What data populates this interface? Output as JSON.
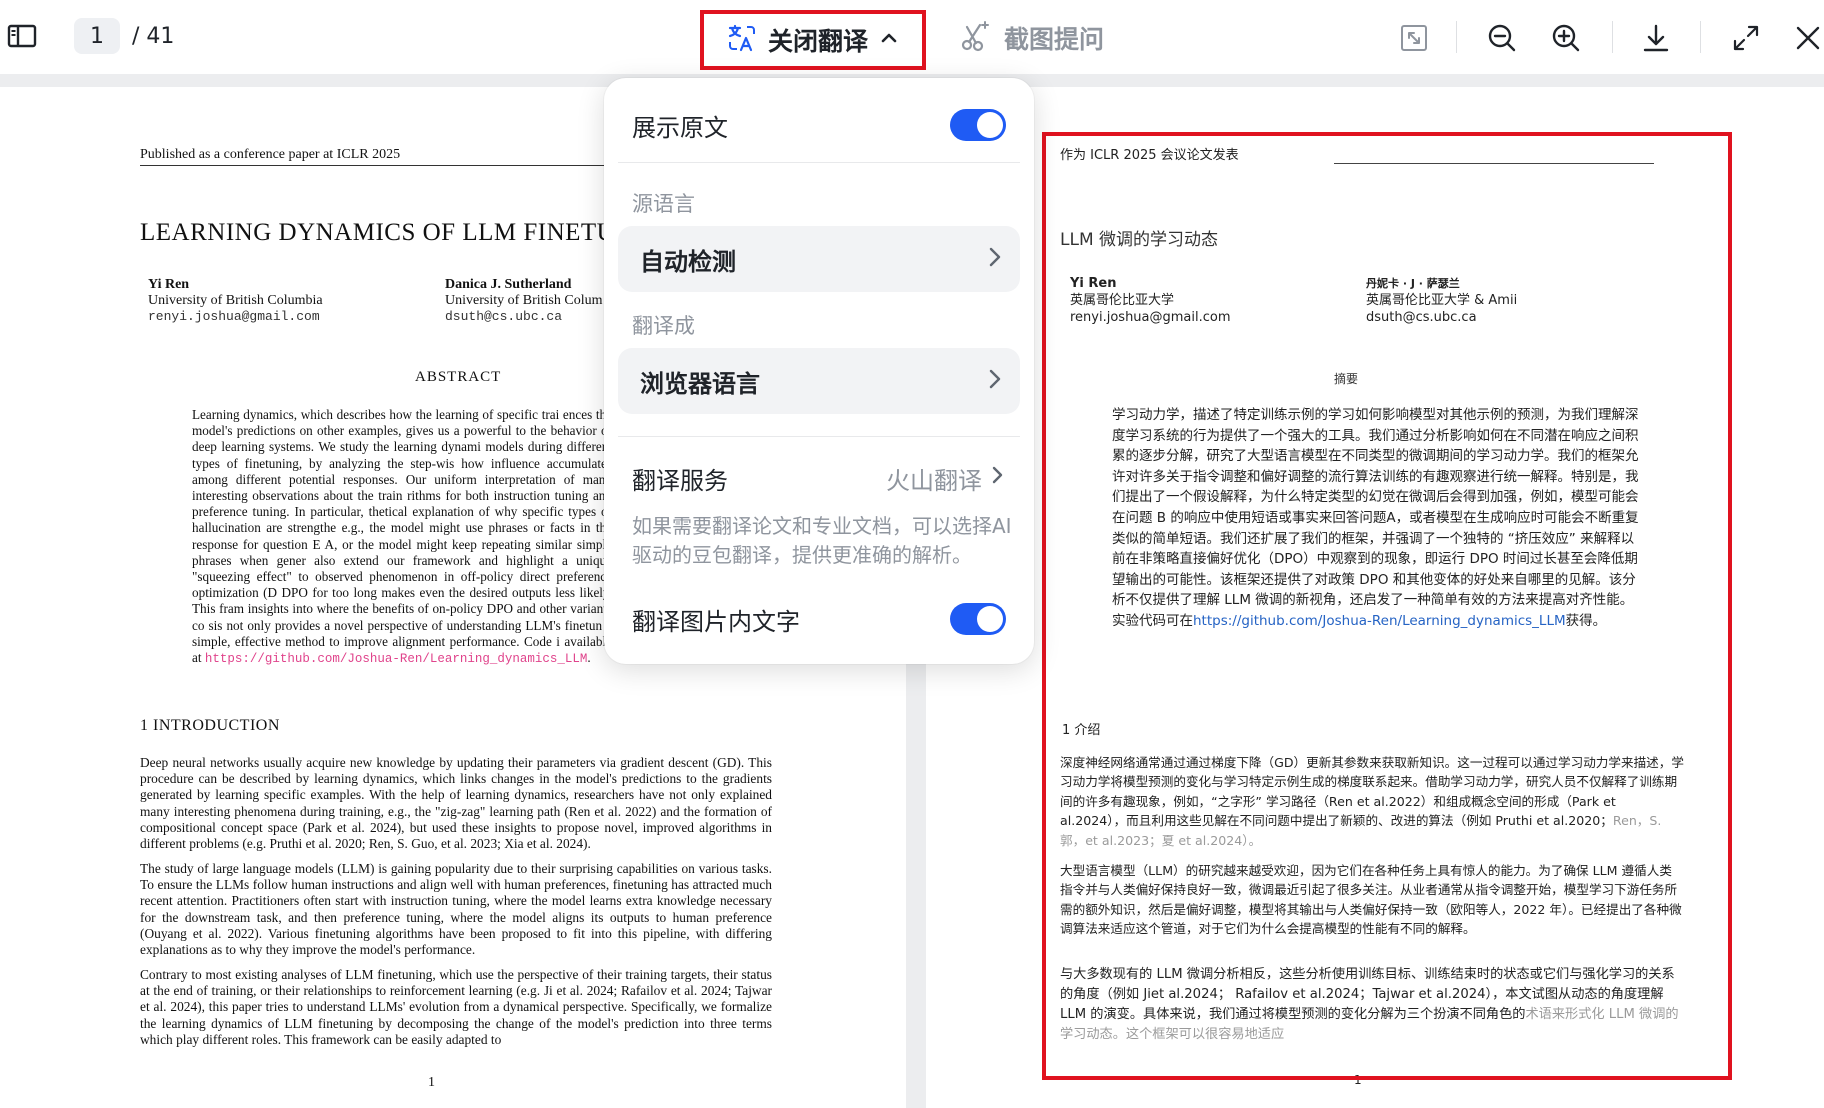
{
  "toolbar": {
    "page_current": "1",
    "page_total": "/ 41",
    "translate_label": "关闭翻译",
    "ask_label": "截图提问",
    "accent_color": "#1f5bf4",
    "highlight_color": "#e0121f"
  },
  "menu": {
    "show_original_label": "展示原文",
    "show_original_on": true,
    "source_lang_label": "源语言",
    "source_lang_value": "自动检测",
    "target_lang_label": "翻译成",
    "target_lang_value": "浏览器语言",
    "service_label": "翻译服务",
    "service_value": "火山翻译",
    "hint": "如果需要翻译论文和专业文档，可以选择AI 驱动的豆包翻译，提供更准确的解析。",
    "translate_image_label": "翻译图片内文字",
    "translate_image_on": true
  },
  "original": {
    "header": "Published as a conference paper at ICLR 2025",
    "title": "LEARNING DYNAMICS OF LLM FINETUNIN",
    "author1_name": "Yi Ren",
    "author1_affil": "University of British Columbia",
    "author1_email": "renyi.joshua@gmail.com",
    "author2_name": "Danica J. Sutherland",
    "author2_affil": "University of British Colum",
    "author2_email": "dsuth@cs.ubc.ca",
    "abstract_heading": "ABSTRACT",
    "abstract": "Learning dynamics, which describes how the learning of specific trai ences the model's predictions on other examples, gives us a powerful to the behavior of deep learning systems. We study the learning dynami models during different types of finetuning, by analyzing the step-wis how influence accumulates among different potential responses. Our uniform interpretation of many interesting observations about the train rithms for both instruction tuning and preference tuning. In particular, thetical explanation of why specific types of hallucination are strengthe e.g., the model might use phrases or facts in the response for question E A, or the model might keep repeating similar simple phrases when gener also extend our framework and highlight a unique \"squeezing effect\" to observed phenomenon in off-policy direct preference optimization (D DPO for too long makes even the desired outputs less likely. This fram insights into where the benefits of on-policy DPO and other variants co sis not only provides a novel perspective of understanding LLM's finetun a simple, effective method to improve alignment performance. Code i available at",
    "abstract_link": "https://github.com/Joshua-Ren/Learning_dynamics_LLM",
    "section_heading": "1 INTRODUCTION",
    "para1": "Deep neural networks usually acquire new knowledge by updating their parameters via gradient descent (GD). This procedure can be described by learning dynamics, which links changes in the model's predictions to the gradients generated by learning specific examples. With the help of learning dynamics, researchers have not only explained many interesting phenomena during training, e.g., the \"zig-zag\" learning path (Ren et al. 2022) and the formation of compositional concept space (Park et al. 2024), but used these insights to propose novel, improved algorithms in different problems (e.g. Pruthi et al. 2020; Ren, S. Guo, et al. 2023; Xia et al. 2024).",
    "para2": "The study of large language models (LLM) is gaining popularity due to their surprising capabilities on various tasks. To ensure the LLMs follow human instructions and align well with human preferences, finetuning has attracted much recent attention. Practitioners often start with instruction tuning, where the model learns extra knowledge necessary for the downstream task, and then preference tuning, where the model aligns its outputs to human preference (Ouyang et al. 2022). Various finetuning algorithms have been proposed to fit into this pipeline, with differing explanations as to why they improve the model's performance.",
    "para3": "Contrary to most existing analyses of LLM finetuning, which use the perspective of their training targets, their status at the end of training, or their relationships to reinforcement learning (e.g. Ji et al. 2024; Rafailov et al. 2024; Tajwar et al. 2024), this paper tries to understand LLMs' evolution from a dynamical perspective. Specifically, we formalize the learning dynamics of LLM finetuning by decomposing the change of the model's prediction into three terms which play different roles. This framework can be easily adapted to",
    "page_number": "1"
  },
  "translated": {
    "header": "作为 ICLR 2025 会议论文发表",
    "title": "LLM 微调的学习动态",
    "author1_name": "Yi Ren",
    "author1_affil": "英属哥伦比亚大学",
    "author1_email": "renyi.joshua@gmail.com",
    "author2_name": "丹妮卡 · J · 萨瑟兰",
    "author2_affil": "英属哥伦比亚大学 & Amii",
    "author2_email": "dsuth@cs.ubc.ca",
    "abstract_heading": "摘要",
    "abstract": "学习动力学，描述了特定训练示例的学习如何影响模型对其他示例的预测，为我们理解深度学习系统的行为提供了一个强大的工具。我们通过分析影响如何在不同潜在响应之间积累的逐步分解，研究了大型语言模型在不同类型的微调期间的学习动力学。我们的框架允许对许多关于指令调整和偏好调整的流行算法训练的有趣观察进行统一解释。特别是，我们提出了一个假设解释，为什么特定类型的幻觉在微调后会得到加强，例如，模型可能会在问题 B 的响应中使用短语或事实来回答问题A，或者模型在生成响应时可能会不断重复类似的简单短语。我们还扩展了我们的框架，并强调了一个独特的 “挤压效应” 来解释以前在非策略直接偏好优化（DPO）中观察到的现象，即运行 DPO 时间过长甚至会降低期望输出的可能性。该框架还提供了对政策 DPO 和其他变体的好处来自哪里的见解。该分析不仅提供了理解 LLM 微调的新视角，还启发了一种简单有效的方法来提高对齐性能。实验代码可在",
    "abstract_link": "https://github.com/Joshua-Ren/Learning_dynamics_LLM",
    "abstract_end": "获得。",
    "section_heading": "1 介绍",
    "para1": "深度神经网络通常通过通过梯度下降（GD）更新其参数来获取新知识。这一过程可以通过学习动力学来描述，学习动力学将模型预测的变化与学习特定示例生成的梯度联系起来。借助学习动力学，研究人员不仅解释了训练期间的许多有趣现象，例如，“之字形” 学习路径（Ren et al.2022）和组成概念空间的形成（Park et al.2024），而且利用这些见解在不同问题中提出了新颖的、改进的算法（例如 Pruthi et al.2020；",
    "para1_fade": "Ren，S. 郭，et al.2023；夏 et al.2024）。",
    "para2": "大型语言模型（LLM）的研究越来越受欢迎，因为它们在各种任务上具有惊人的能力。为了确保 LLM 遵循人类指令并与人类偏好保持良好一致，微调最近引起了很多关注。从业者通常从指令调整开始，模型学习下游任务所需的额外知识，然后是偏好调整，模型将其输出与人类偏好保持一致（欧阳等人，2022 年）。已经提出了各种微调算法来适应这个管道，对于它们为什么会提高模型的性能有不同的解释。",
    "para3": "与大多数现有的 LLM 微调分析相反，这些分析使用训练目标、训练结束时的状态或它们与强化学习的关系的角度（例如 Jiet al.2024； Rafailov et al.2024；Tajwar et al.2024），本文试图从动态的角度理解 LLM 的演变。具体来说，我们通过将模型预测的变化分解为三个扮演不同角色的",
    "para3_fade": "术语来形式化 LLM 微调的学习动态。这个框架可以很容易地适应",
    "page_number": "1"
  }
}
